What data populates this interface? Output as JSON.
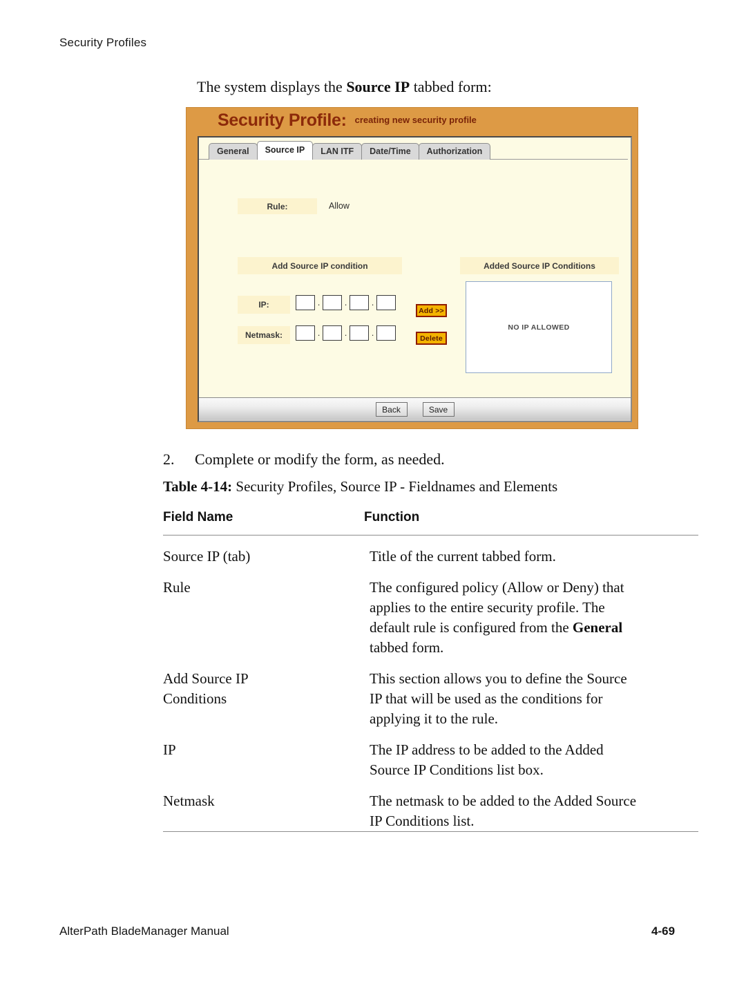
{
  "page": {
    "running_header": "Security Profiles",
    "intro_prefix": "The system displays the ",
    "intro_bold": "Source IP",
    "intro_suffix": " tabbed form:"
  },
  "screenshot": {
    "title": "Security Profile:",
    "subtitle": "creating new security profile",
    "colors": {
      "titlebar_bg": "#DD9A45",
      "title_text": "#8C2A0A",
      "form_bg": "#FDFBE4",
      "chip_bg": "#FCF3CE",
      "gold_button_bg": "#F4B300",
      "gold_button_border": "#8E1B00"
    },
    "tabs": [
      {
        "label": "General",
        "active": false
      },
      {
        "label": "Source IP",
        "active": true
      },
      {
        "label": "LAN ITF",
        "active": false
      },
      {
        "label": "Date/Time",
        "active": false
      },
      {
        "label": "Authorization",
        "active": false
      }
    ],
    "form": {
      "rule_label": "Rule:",
      "rule_value": "Allow",
      "add_condition_header": "Add Source IP condition",
      "added_conditions_header": "Added Source IP Conditions",
      "ip_label": "IP:",
      "netmask_label": "Netmask:",
      "ip_octets": [
        "",
        "",
        "",
        ""
      ],
      "netmask_octets": [
        "",
        "",
        "",
        ""
      ],
      "octet_separator": ".",
      "add_button": "Add >>",
      "delete_button": "Delete",
      "listbox_empty_text": "NO IP ALLOWED"
    },
    "actions": {
      "back_button": "Back",
      "save_button": "Save"
    }
  },
  "step": {
    "number": "2.",
    "text": "Complete or modify the form, as needed."
  },
  "table": {
    "caption_label": "Table 4-14:",
    "caption_text": " Security Profiles, Source IP - Fieldnames and Elements",
    "headers": [
      "Field Name",
      "Function"
    ],
    "rows": [
      {
        "field": [
          "Source IP (tab)"
        ],
        "function_lines": [
          {
            "text": "Title of the current tabbed form."
          }
        ]
      },
      {
        "field": [
          "Rule"
        ],
        "function_lines": [
          {
            "text": "The configured policy (Allow or Deny) that"
          },
          {
            "text": "applies to the entire security profile. The"
          },
          {
            "pre": "default rule is configured from the ",
            "bold": "General"
          },
          {
            "text": "tabbed form."
          }
        ]
      },
      {
        "field": [
          "Add Source IP",
          "Conditions"
        ],
        "function_lines": [
          {
            "text": "This section allows you to define the Source"
          },
          {
            "text": "IP that will be used as the conditions for"
          },
          {
            "text": "applying it to the rule."
          }
        ]
      },
      {
        "field": [
          "IP"
        ],
        "function_lines": [
          {
            "text": "The IP address to be added to the Added"
          },
          {
            "text": "Source IP Conditions list box."
          }
        ]
      },
      {
        "field": [
          "Netmask"
        ],
        "function_lines": [
          {
            "text": "The netmask to be added to the Added Source"
          },
          {
            "text": "IP Conditions list."
          }
        ]
      }
    ]
  },
  "footer": {
    "manual_title": "AlterPath BladeManager Manual",
    "page_number": "4-69"
  }
}
